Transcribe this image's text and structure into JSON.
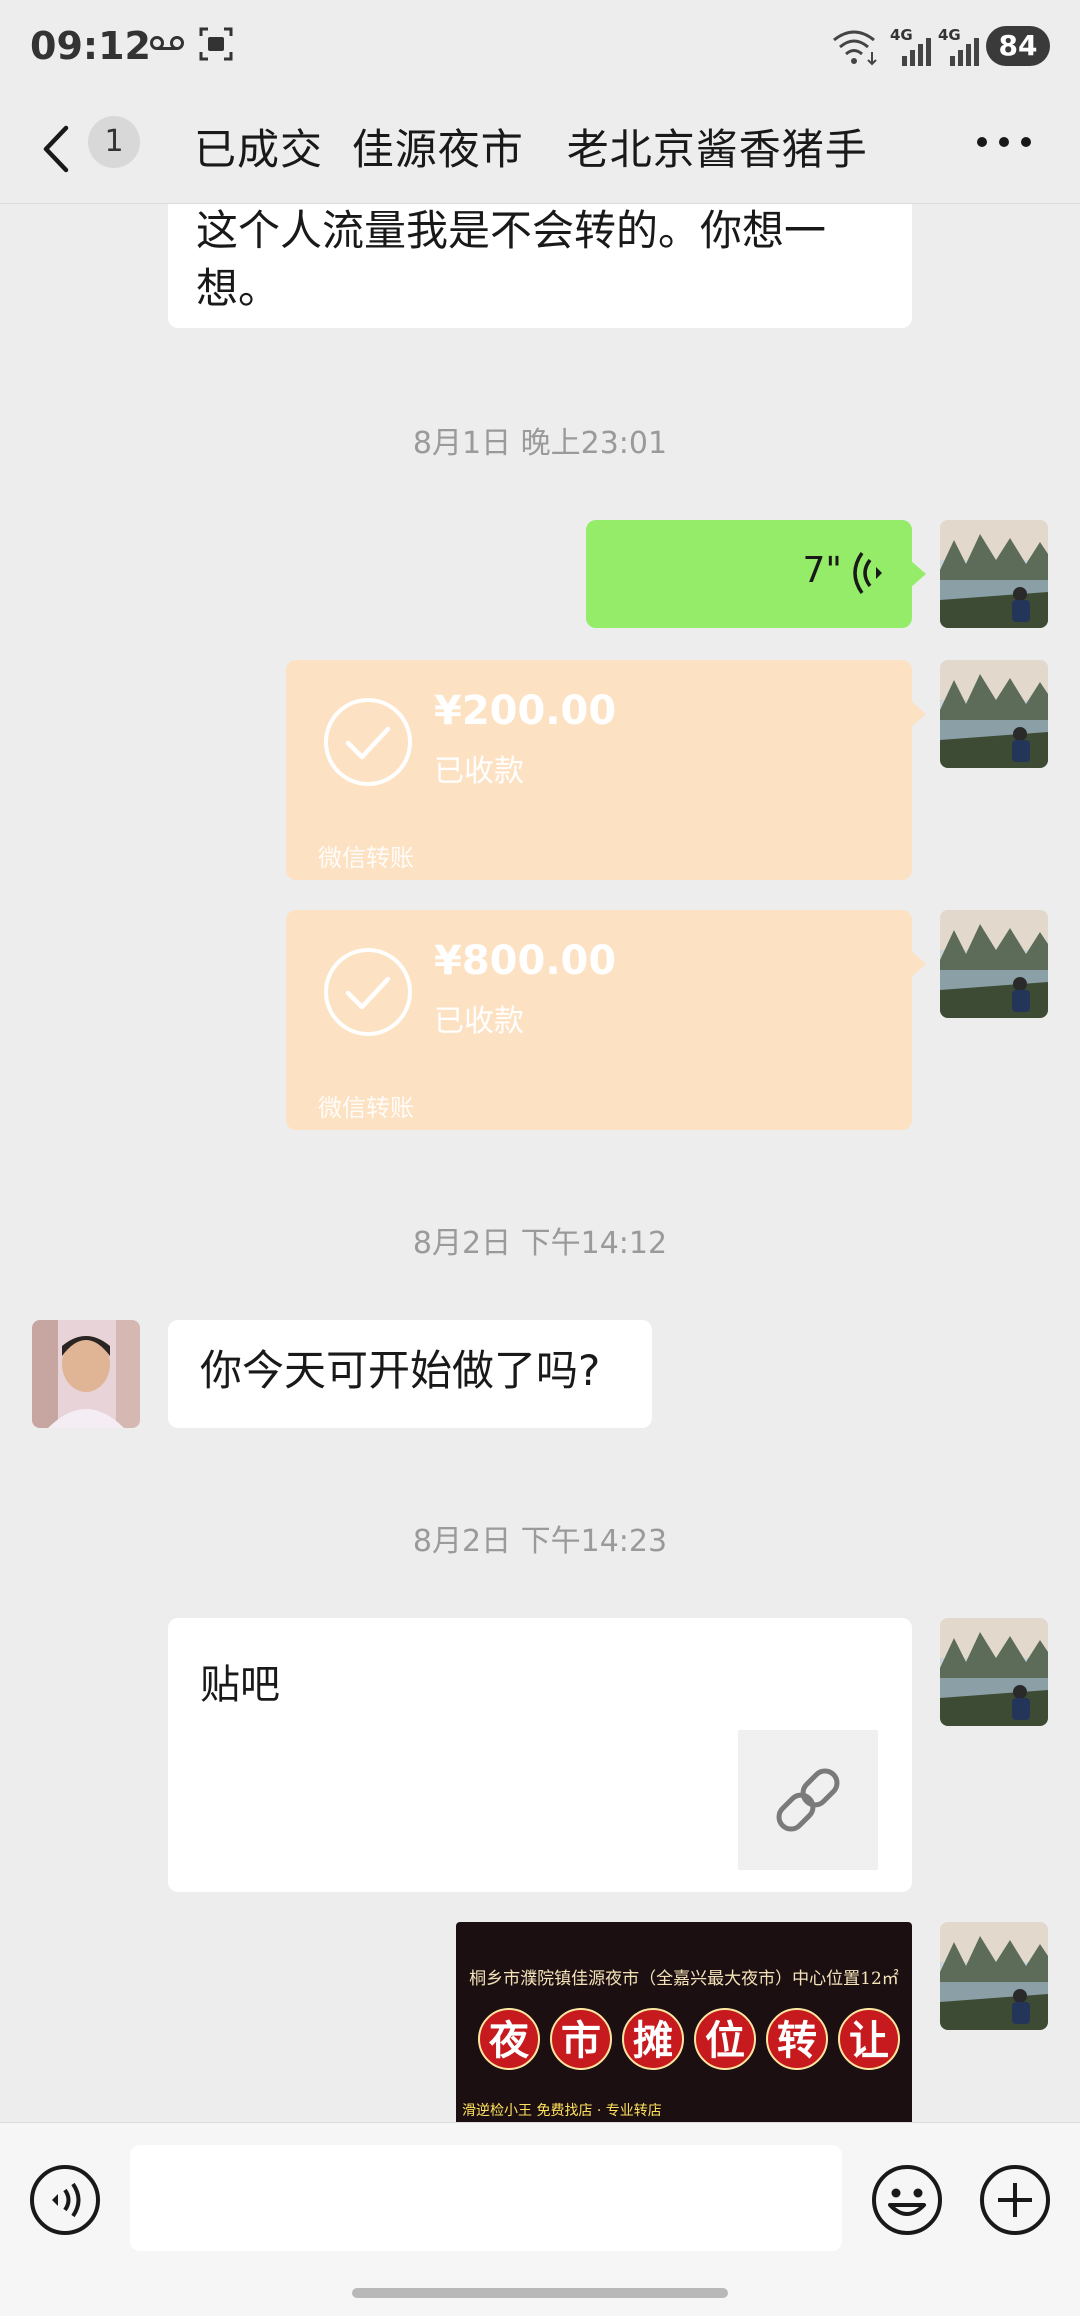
{
  "status_bar": {
    "time": "09:12",
    "network_1": "4G",
    "network_2": "4G",
    "battery": "84"
  },
  "header": {
    "unread_count": "1",
    "title": "已成交  佳源夜市   老北京酱香猪手"
  },
  "messages": {
    "partial_text_line1": "这个人流量我是不会转的。你想一",
    "partial_text_line2": "想。",
    "time_1": "8月1日 晚上23:01",
    "voice_duration": "7\"",
    "transfer_1": {
      "amount": "¥200.00",
      "status": "已收款",
      "source": "微信转账"
    },
    "transfer_2": {
      "amount": "¥800.00",
      "status": "已收款",
      "source": "微信转账"
    },
    "time_2": "8月2日 下午14:12",
    "incoming_text": "你今天可开始做了吗?",
    "time_3": "8月2日 下午14:23",
    "link_title": "贴吧",
    "image": {
      "caption": "桐乡市濮院镇佳源夜市（全嘉兴最大夜市）中心位置12㎡",
      "title_chars": [
        "夜",
        "市",
        "摊",
        "位",
        "转",
        "让"
      ],
      "bottom_text": "滑逆检小王  免费找店 · 专业转店"
    }
  },
  "colors": {
    "sent_bubble": "#95ec69",
    "transfer_bubble": "#fde1c3",
    "background": "#ededed"
  },
  "icons": {
    "back": "chevron-left-icon",
    "more": "more-dots-icon",
    "voice_wave": "voice-wave-icon",
    "check": "check-circle-icon",
    "link": "link-icon",
    "voice_toggle": "voice-input-icon",
    "emoji": "emoji-icon",
    "plus": "plus-circle-icon"
  }
}
